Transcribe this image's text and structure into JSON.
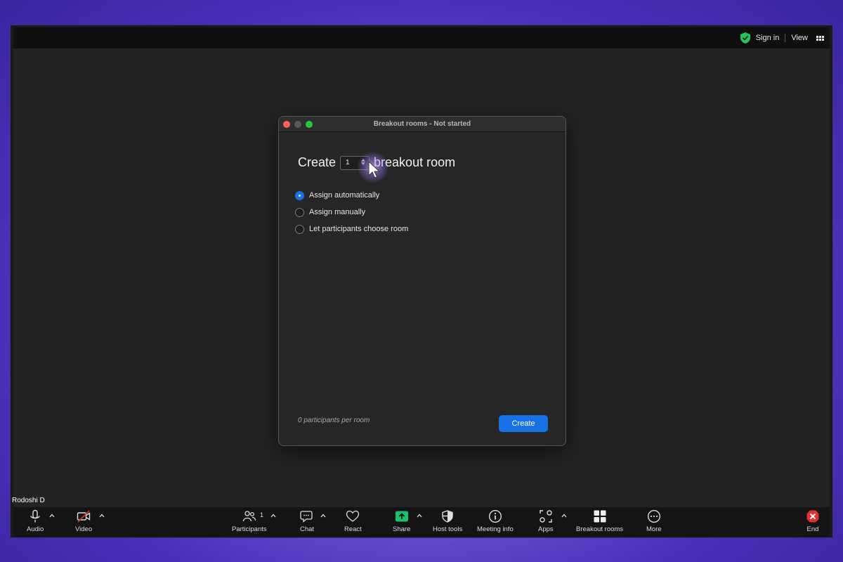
{
  "topbar": {
    "sign_in": "Sign in",
    "view": "View"
  },
  "participant": {
    "name": "Rodoshi D"
  },
  "dialog": {
    "title": "Breakout rooms - Not started",
    "create_prefix": "Create",
    "room_count": "1",
    "create_suffix": "breakout room",
    "options": [
      {
        "label": "Assign automatically",
        "checked": true
      },
      {
        "label": "Assign manually",
        "checked": false
      },
      {
        "label": "Let participants choose room",
        "checked": false
      }
    ],
    "per_room": "0 participants per room",
    "create_button": "Create"
  },
  "toolbar": {
    "audio": "Audio",
    "video": "Video",
    "participants": "Participants",
    "participant_count": "1",
    "chat": "Chat",
    "react": "React",
    "share": "Share",
    "host_tools": "Host tools",
    "meeting_info": "Meeting info",
    "apps": "Apps",
    "breakout_rooms": "Breakout rooms",
    "more": "More",
    "end": "End"
  },
  "colors": {
    "accent": "#1672e6",
    "share_green": "#18c26b",
    "end_red": "#e0312f",
    "shield_green": "#22c55e"
  }
}
